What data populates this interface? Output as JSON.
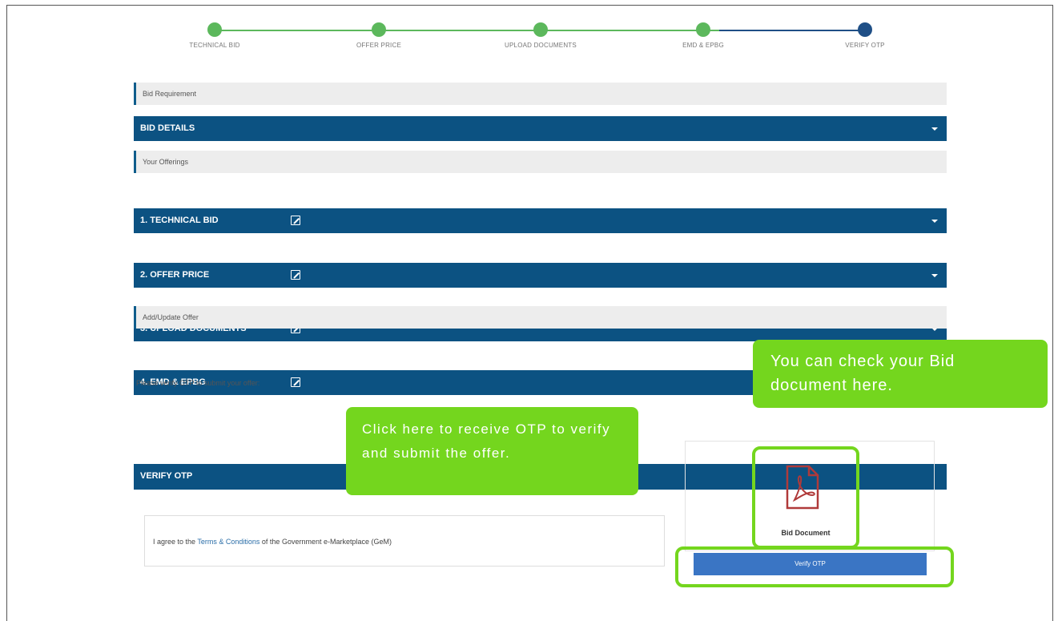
{
  "stepper": {
    "steps": [
      {
        "label": "TECHNICAL BID",
        "color": "#5cb85c"
      },
      {
        "label": "OFFER PRICE",
        "color": "#5cb85c"
      },
      {
        "label": "UPLOAD DOCUMENTS",
        "color": "#5cb85c"
      },
      {
        "label": "EMD & EPBG",
        "color": "#5cb85c"
      },
      {
        "label": "VERIFY OTP",
        "color": "#1f4f86"
      }
    ]
  },
  "sections": {
    "bid_requirement": "Bid Requirement",
    "bid_details": "BID DETAILS",
    "your_offerings": "Your Offerings",
    "offerings": [
      "1. TECHNICAL BID",
      "2. OFFER PRICE",
      "3. UPLOAD DOCUMENTS",
      "4. EMD & EPBG"
    ],
    "add_update_offer": "Add/Update Offer",
    "verify_otp": "VERIFY OTP"
  },
  "note": "Please verify OTP to submit your offer:",
  "agree": {
    "prefix": "I agree to the ",
    "link": "Terms & Conditions",
    "suffix": " of the Government e-Marketplace (GeM)"
  },
  "bid_document_label": "Bid Document",
  "verify_button_label": "Verify OTP",
  "callouts": {
    "otp": "Click here to receive OTP to verify and submit the offer.",
    "doc": "You can check your Bid document here."
  },
  "colors": {
    "primary_blue": "#0c5282",
    "callout_green": "#74d61e",
    "button_blue": "#3a75c4"
  },
  "icons": [
    "pdf-document-icon",
    "edit-icon",
    "caret-down-icon"
  ]
}
